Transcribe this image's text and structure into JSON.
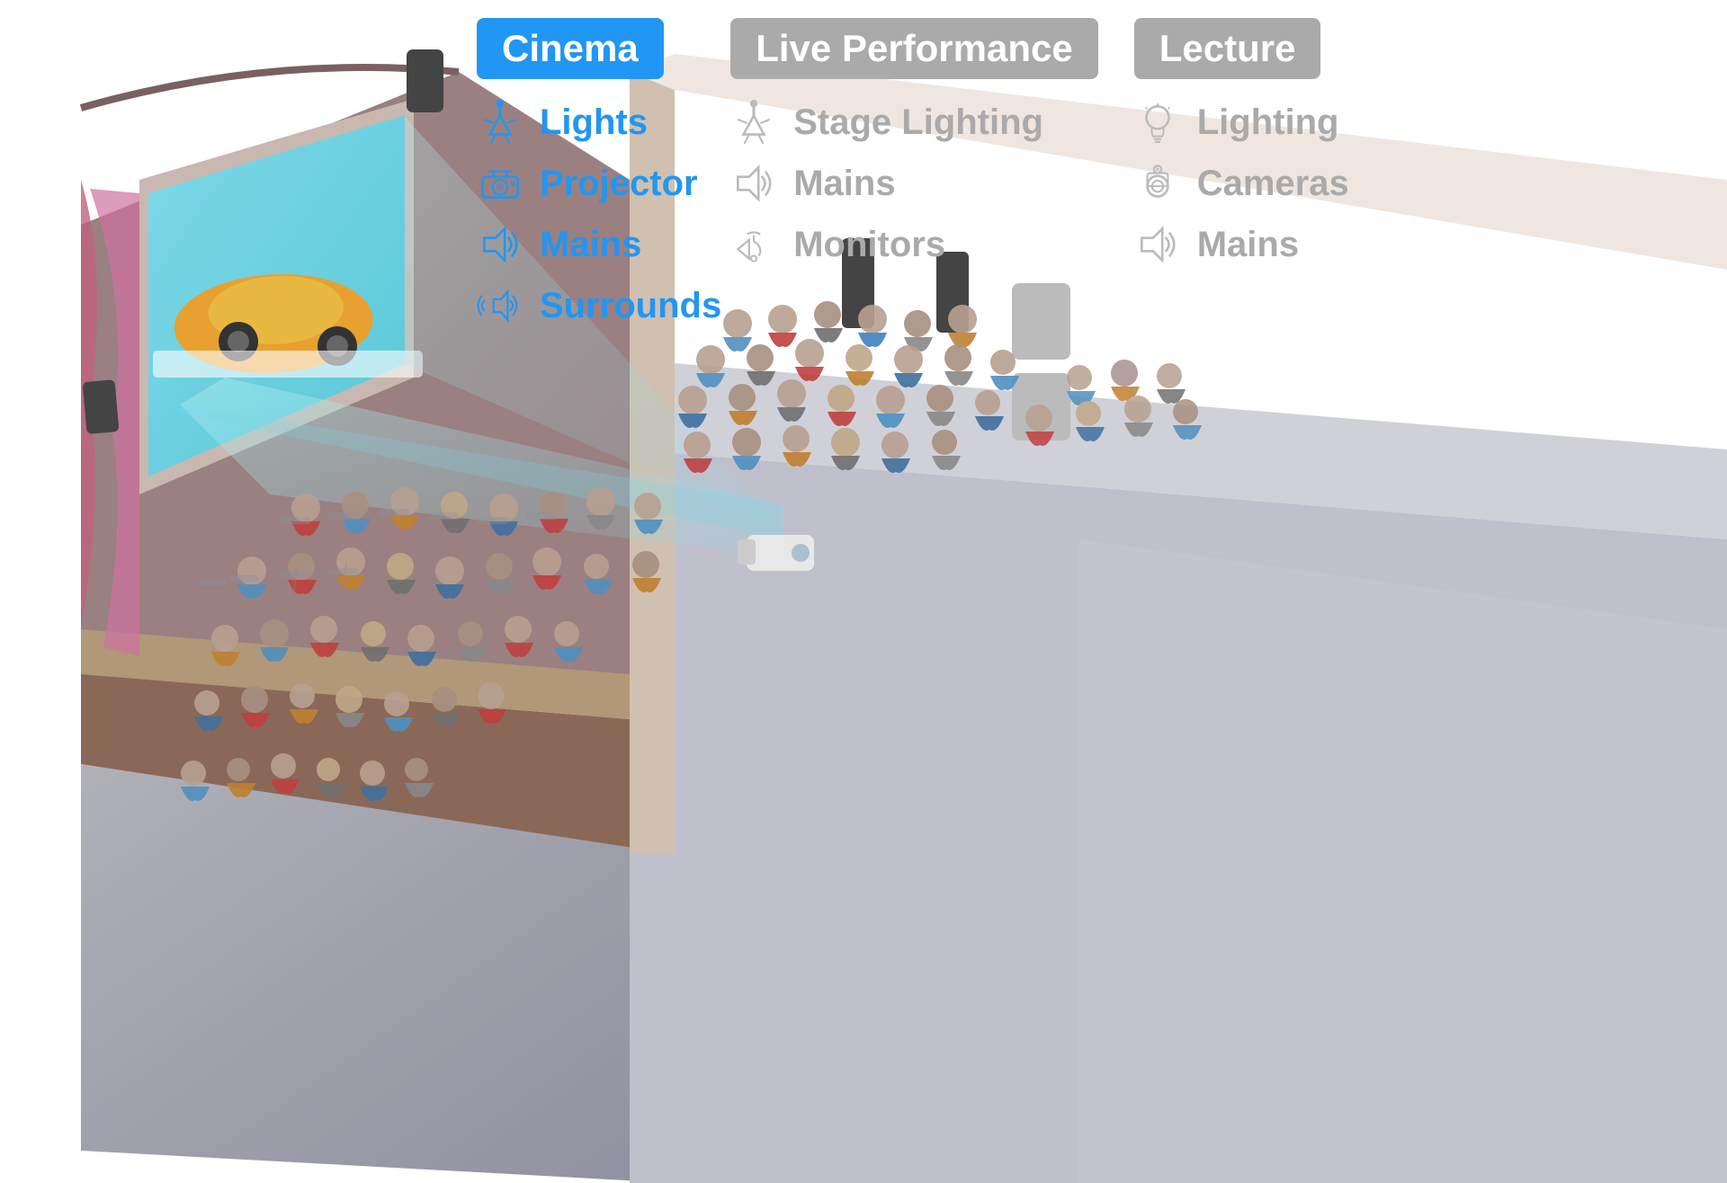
{
  "categories": {
    "cinema": {
      "label": "Cinema",
      "active": true,
      "items": [
        {
          "id": "lights",
          "label": "Lights",
          "icon": "stage-light"
        },
        {
          "id": "projector",
          "label": "Projector",
          "icon": "projector"
        },
        {
          "id": "mains",
          "label": "Mains",
          "icon": "speaker"
        },
        {
          "id": "surrounds",
          "label": "Surrounds",
          "icon": "surround-speaker"
        }
      ]
    },
    "live_performance": {
      "label": "Live Performance",
      "active": false,
      "items": [
        {
          "id": "stage_lighting",
          "label": "Stage Lighting",
          "icon": "stage-light-gray"
        },
        {
          "id": "mains",
          "label": "Mains",
          "icon": "speaker-gray"
        },
        {
          "id": "monitors",
          "label": "Monitors",
          "icon": "monitor-gray"
        }
      ]
    },
    "lecture": {
      "label": "Lecture",
      "active": false,
      "items": [
        {
          "id": "lighting",
          "label": "Lighting",
          "icon": "bulb-gray"
        },
        {
          "id": "cameras",
          "label": "Cameras",
          "icon": "camera-gray"
        },
        {
          "id": "mains",
          "label": "Mains",
          "icon": "speaker-gray"
        }
      ]
    }
  }
}
